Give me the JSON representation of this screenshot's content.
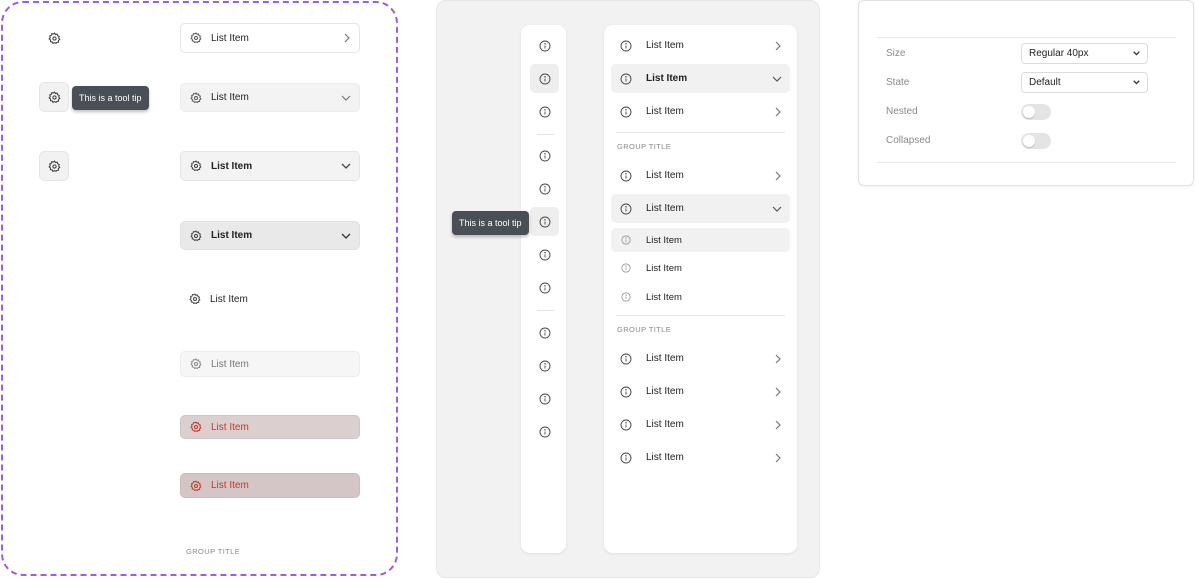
{
  "panel1": {
    "tooltip": "This is a tool tip",
    "items": [
      {
        "label": "List Item",
        "trailing": "chevron-right-icon"
      },
      {
        "label": "List Item",
        "trailing": "chevron-down-icon"
      },
      {
        "label": "List Item",
        "trailing": "chevron-down-icon"
      },
      {
        "label": "List Item",
        "trailing": "chevron-down-icon"
      },
      {
        "label": "List Item"
      },
      {
        "label": "List Item"
      },
      {
        "label": "List Item"
      },
      {
        "label": "List Item"
      }
    ],
    "group_title": "GROUP TITLE",
    "colors": {
      "border": "#9b5de5",
      "danger_text": "#c0392b"
    }
  },
  "panel2": {
    "tooltip": "This is a tool tip",
    "rail_icons": [
      "info-icon",
      "info-icon",
      "info-icon",
      "info-icon",
      "info-icon",
      "info-icon",
      "info-icon",
      "info-icon",
      "info-icon",
      "info-icon",
      "info-icon",
      "info-icon"
    ],
    "menu": {
      "top_items": [
        {
          "label": "List Item"
        },
        {
          "label": "List Item"
        },
        {
          "label": "List Item"
        }
      ],
      "group1_title": "GROUP TITLE",
      "group1_items": [
        {
          "label": "List Item"
        },
        {
          "label": "List Item"
        }
      ],
      "nested_items": [
        {
          "label": "List Item"
        },
        {
          "label": "List Item"
        },
        {
          "label": "List Item"
        }
      ],
      "group2_title": "GROUP TITLE",
      "group2_items": [
        {
          "label": "List Item"
        },
        {
          "label": "List Item"
        },
        {
          "label": "List Item"
        },
        {
          "label": "List Item"
        }
      ]
    }
  },
  "panel3": {
    "size_label": "Size",
    "size_value": "Regular 40px",
    "state_label": "State",
    "state_value": "Default",
    "nested_label": "Nested",
    "nested_on": false,
    "collapsed_label": "Collapsed",
    "collapsed_on": false
  }
}
